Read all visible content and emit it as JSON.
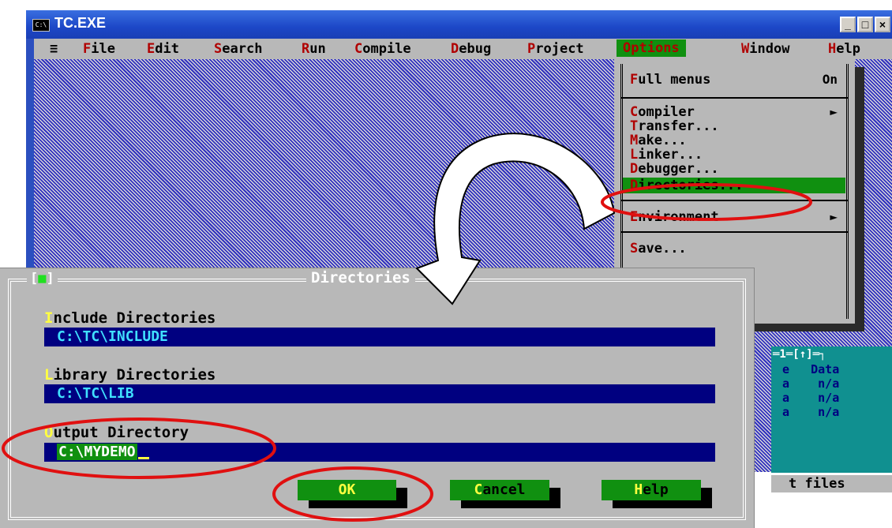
{
  "window": {
    "icon": "C:\\",
    "title": "TC.EXE",
    "controls": {
      "minimize": "_",
      "maximize": "□",
      "close": "×"
    }
  },
  "menubar": {
    "system": "≡",
    "items": [
      {
        "hot": "F",
        "rest": "ile"
      },
      {
        "hot": "E",
        "rest": "dit"
      },
      {
        "hot": "S",
        "rest": "earch"
      },
      {
        "hot": "R",
        "rest": "un"
      },
      {
        "hot": "C",
        "rest": "ompile"
      },
      {
        "hot": "D",
        "rest": "ebug"
      },
      {
        "hot": "P",
        "rest": "roject"
      },
      {
        "hot": "O",
        "rest": "ptions"
      },
      {
        "hot": "W",
        "rest": "indow"
      },
      {
        "hot": "H",
        "rest": "elp"
      }
    ],
    "selected": "Options"
  },
  "options_menu": {
    "full_menus": {
      "hot": "F",
      "rest": "ull menus",
      "value": "On"
    },
    "compiler": {
      "hot": "C",
      "rest": "ompiler"
    },
    "transfer": {
      "hot": "T",
      "rest": "ransfer..."
    },
    "make": {
      "hot": "M",
      "rest": "ake..."
    },
    "linker": {
      "hot": "L",
      "rest": "inker..."
    },
    "debugger": {
      "hot": "D",
      "rest": "ebugger..."
    },
    "directories": {
      "hot": "D",
      "rest": "irectories..."
    },
    "environment": {
      "hot": "E",
      "rest": "nvironment"
    },
    "save": {
      "hot": "S",
      "rest": "ave..."
    },
    "submenu_arrow": "►"
  },
  "watch_window": {
    "title": "═1═[↑]═┐",
    "header": "e   Data",
    "rows": [
      "a    n/a",
      "a    n/a",
      "a    n/a"
    ],
    "status": "t files"
  },
  "dialog": {
    "closebox": [
      "[",
      "■",
      "]"
    ],
    "title": "Directories",
    "include": {
      "hot": "I",
      "rest": "nclude Directories",
      "value": "C:\\TC\\INCLUDE"
    },
    "library": {
      "hot": "L",
      "rest": "ibrary Directories",
      "value": "C:\\TC\\LIB"
    },
    "output": {
      "hot": "O",
      "rest": "utput Directory",
      "value": "C:\\MYDEMO"
    },
    "buttons": {
      "ok": "OK",
      "cancel": {
        "hot": "C",
        "rest": "ancel"
      },
      "help": {
        "hot": "H",
        "rest": "elp"
      }
    }
  },
  "annotations": {
    "highlight_color": "#e01010",
    "arrow_color": "#ffffff"
  }
}
